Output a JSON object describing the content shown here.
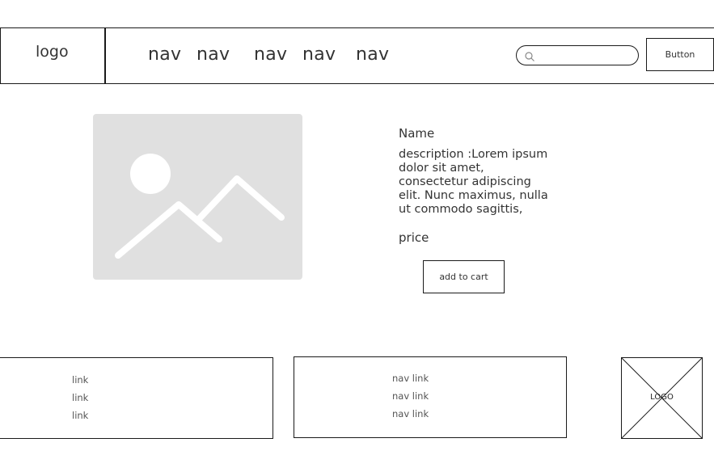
{
  "header": {
    "logo_text": "logo",
    "nav_items": [
      "nav",
      "nav",
      "nav",
      "nav",
      "nav"
    ],
    "search": {
      "placeholder": "",
      "value": ""
    },
    "button_label": "Button"
  },
  "product": {
    "image_icon": "image-placeholder-icon",
    "name": "Name",
    "description": "description :Lorem ipsum dolor sit amet, consectetur adipiscing elit. Nunc maximus, nulla ut commodo sagittis,",
    "price": "price",
    "add_to_cart_label": "add to cart"
  },
  "footer": {
    "column1_links": [
      "link",
      "link",
      "link"
    ],
    "column2_links": [
      "nav link",
      "nav link",
      "nav link"
    ],
    "logo_text": "LOGO"
  },
  "colors": {
    "border": "#1a1a1a",
    "image_placeholder_bg": "#e0e0e0",
    "text": "#333333"
  }
}
